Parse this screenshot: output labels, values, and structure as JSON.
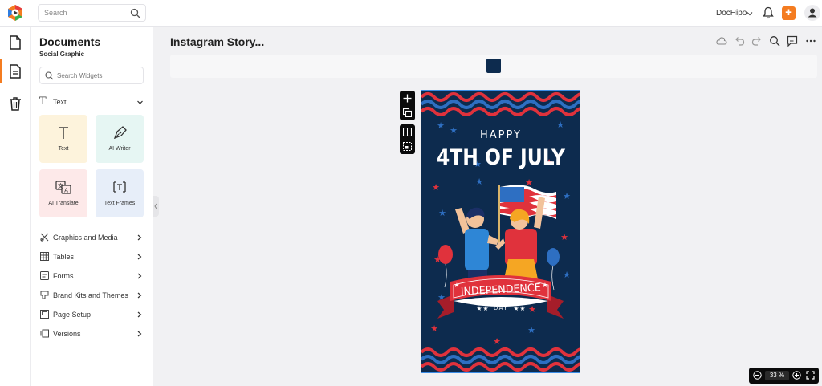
{
  "topbar": {
    "search_placeholder": "Search",
    "brand": "DocHipo",
    "add_label": "+"
  },
  "panel": {
    "title": "Documents",
    "subtitle": "Social Graphic",
    "widget_search_placeholder": "Search Widgets",
    "text_section": "Text",
    "cards": [
      {
        "label": "Text",
        "icon": "text-icon",
        "bg": "#fdf3dc"
      },
      {
        "label": "AI Writer",
        "icon": "pen-nib-icon",
        "bg": "#e6f6f3"
      },
      {
        "label": "AI Translate",
        "icon": "translate-icon",
        "bg": "#fde9e9"
      },
      {
        "label": "Text Frames",
        "icon": "text-frame-icon",
        "bg": "#e7eef9"
      }
    ],
    "menu": [
      {
        "label": "Graphics and Media",
        "icon": "graphics-icon"
      },
      {
        "label": "Tables",
        "icon": "table-icon"
      },
      {
        "label": "Forms",
        "icon": "form-icon"
      },
      {
        "label": "Brand Kits and Themes",
        "icon": "brand-kit-icon"
      },
      {
        "label": "Page Setup",
        "icon": "page-setup-icon"
      },
      {
        "label": "Versions",
        "icon": "versions-icon"
      }
    ]
  },
  "editor": {
    "doc_title": "Instagram Story...",
    "palette_color": "#0d2b4e"
  },
  "design": {
    "line1": "HAPPY",
    "line2": "4TH OF JULY",
    "banner": "INDEPENDENCE",
    "banner_sub": "DAY",
    "bg_color": "#0d2b4e",
    "accent_red": "#e0323c",
    "accent_blue": "#2e6fc2"
  },
  "zoom": {
    "value": "33",
    "unit": "%"
  },
  "colors": {
    "accent": "#f47c20"
  }
}
